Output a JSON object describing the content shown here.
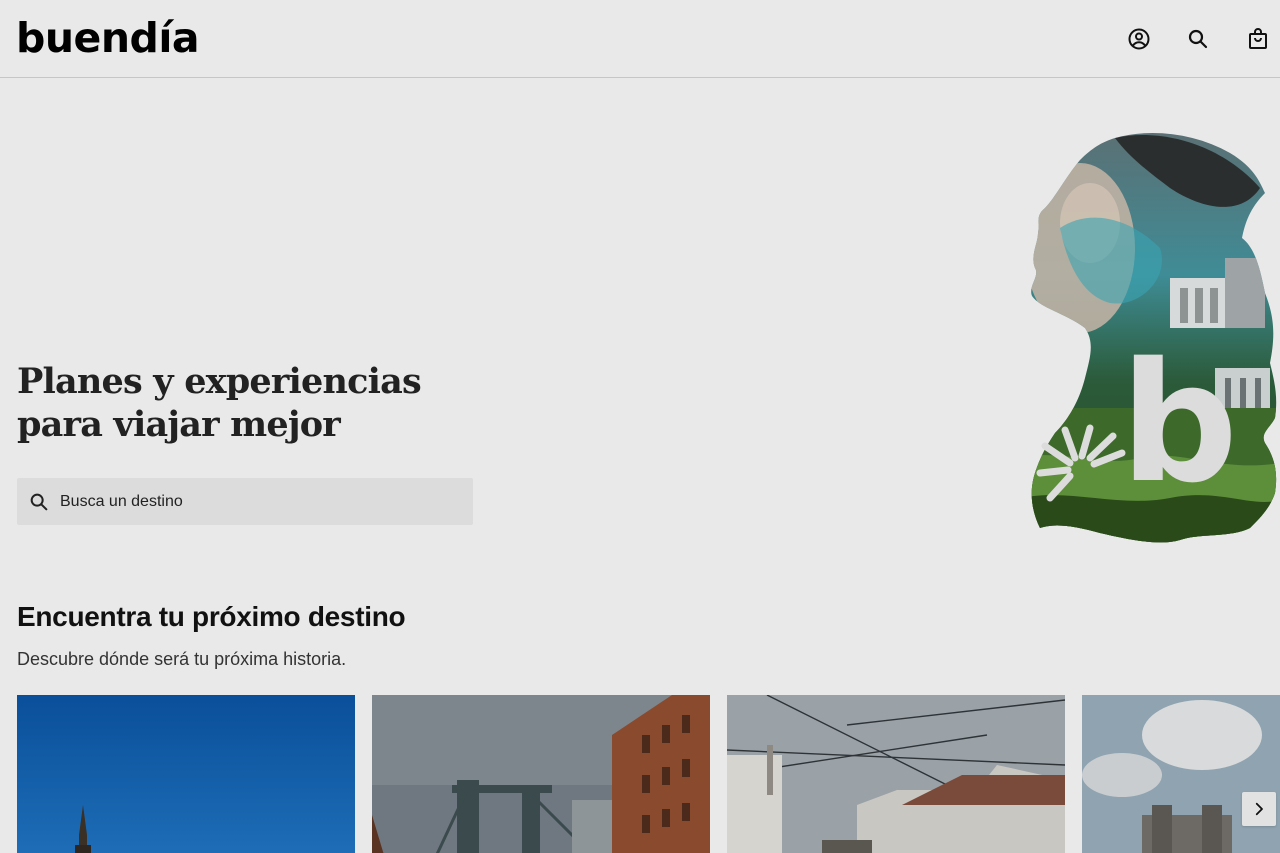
{
  "header": {
    "logo": "buendía",
    "icons": {
      "account": "account-icon",
      "search": "search-icon",
      "cart": "shopping-bag-icon"
    }
  },
  "hero": {
    "title_line1": "Planes y experiencias",
    "title_line2": "para viajar mejor",
    "search": {
      "placeholder": "Busca un destino",
      "value": ""
    },
    "art_letter": "b"
  },
  "destinations": {
    "title": "Encuentra tu próximo destino",
    "subtitle": "Descubre dónde será tu próxima historia.",
    "next_icon": "chevron-right-icon"
  },
  "colors": {
    "background": "#e9e9e9",
    "text": "#111111",
    "search_bg": "#dcdcdc"
  }
}
